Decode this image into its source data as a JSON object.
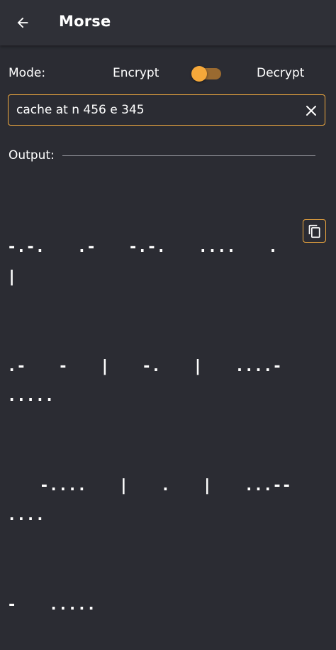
{
  "appbar": {
    "title": "Morse",
    "back_icon": "arrow-left-icon"
  },
  "mode": {
    "label": "Mode:",
    "encrypt_label": "Encrypt",
    "decrypt_label": "Decrypt",
    "switch_state": "encrypt"
  },
  "input": {
    "value": "cache at n 456 e 345",
    "clear_icon": "close-icon"
  },
  "output": {
    "label": "Output:",
    "morse_lines": [
      "-.-.   .-   -.-.   ....   .   |",
      ".-   -   |   -.   |   ....-   .....",
      "   -....   |   .   |   ...--   ....",
      "-   ....."
    ],
    "copy_icon": "copy-icon"
  },
  "colors": {
    "accent": "#f0a93f",
    "background": "#2b2c33",
    "appbar": "#2f3037",
    "text": "#ffffff"
  }
}
